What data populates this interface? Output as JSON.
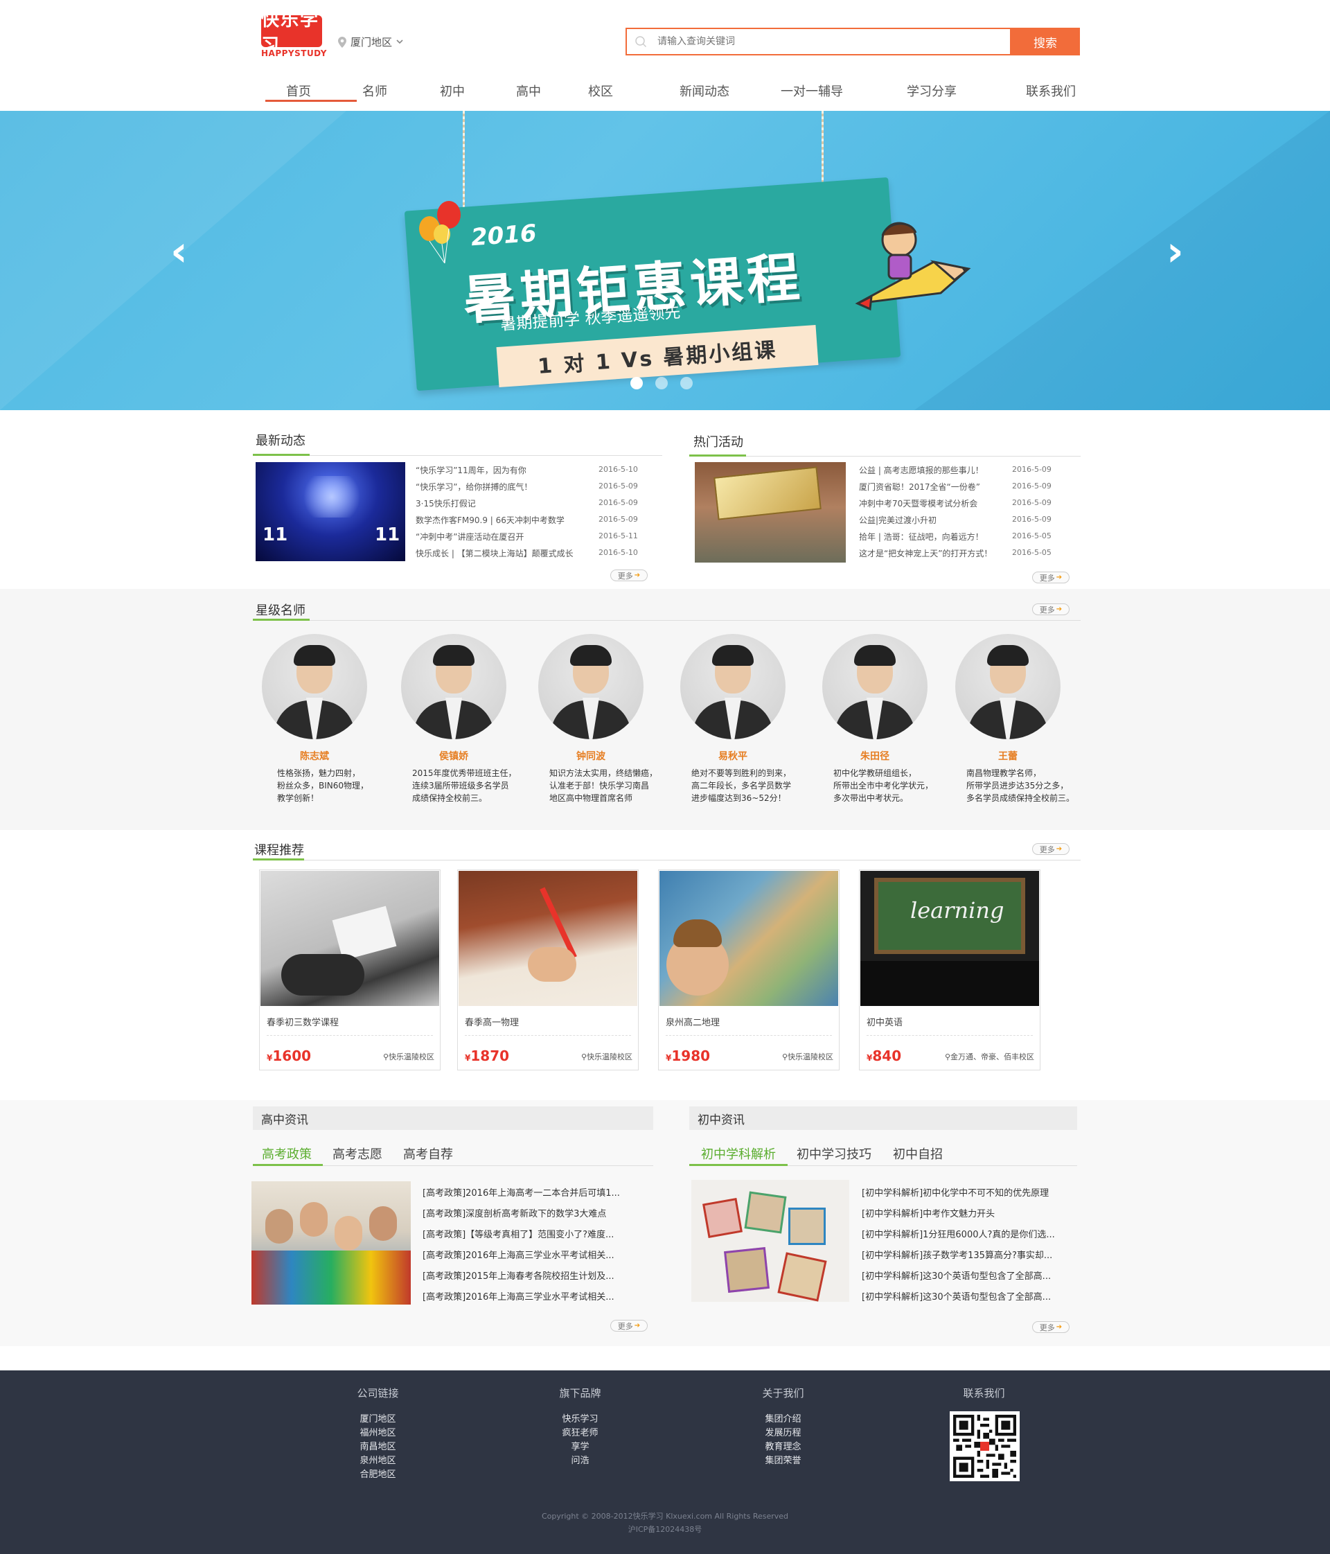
{
  "header": {
    "logo_text": "快乐学习",
    "logo_sub": "HAPPYSTUDY",
    "region": "厦门地区",
    "search_placeholder": "请输入查询关键词",
    "search_button": "搜索"
  },
  "nav": [
    "首页",
    "名师",
    "初中",
    "高中",
    "校区",
    "新闻动态",
    "一对一辅导",
    "学习分享",
    "联系我们"
  ],
  "banner": {
    "year": "2016",
    "title": "暑期钜惠课程",
    "subtitle": "暑期提前学 秋季遥遥领先",
    "tag": "1 对 1 Vs 暑期小组课",
    "slide_count": 3,
    "active_slide": 1
  },
  "latest": {
    "title": "最新动态",
    "more": "更多",
    "items": [
      {
        "text": "“快乐学习”11周年，因为有你",
        "date": "2016-5-10"
      },
      {
        "text": "“快乐学习”，给你拼搏的底气！",
        "date": "2016-5-09"
      },
      {
        "text": "3·15快乐打假记",
        "date": "2016-5-09"
      },
      {
        "text": "数学杰作客FM90.9 | 66天冲刺中考数学",
        "date": "2016-5-09"
      },
      {
        "text": "“冲刺中考”讲座活动在厦召开",
        "date": "2016-5-11"
      },
      {
        "text": "快乐成长 | 【第二模块上海站】颠覆式成长",
        "date": "2016-5-10"
      }
    ]
  },
  "hot": {
    "title": "热门活动",
    "more": "更多",
    "items": [
      {
        "text": "公益 | 高考志愿填报的那些事儿！",
        "date": "2016-5-09"
      },
      {
        "text": "厦门资省聪！2017全省“一份卷”",
        "date": "2016-5-09"
      },
      {
        "text": "冲刺中考70天暨零模考试分析会",
        "date": "2016-5-09"
      },
      {
        "text": "公益|完美过渡小升初",
        "date": "2016-5-09"
      },
      {
        "text": "拾年 | 浩哥：征战吧，向着远方！",
        "date": "2016-5-05"
      },
      {
        "text": "这才是“把女神宠上天”的打开方式！",
        "date": "2016-5-05"
      }
    ]
  },
  "teachers": {
    "title": "星级名师",
    "more": "更多",
    "items": [
      {
        "name": "陈志斌",
        "desc": [
          "性格张扬，魅力四射，",
          "粉丝众多，BIN60物理，",
          "教学创新！"
        ]
      },
      {
        "name": "侯镇娇",
        "desc": [
          "2015年度优秀带班班主任，",
          "连续3届所带班级多名学员",
          "成绩保持全校前三。"
        ]
      },
      {
        "name": "钟同波",
        "desc": [
          "知识方法太实用，终结懒癌，",
          "认准老于部！快乐学习南昌",
          "地区高中物理首席名师"
        ]
      },
      {
        "name": "易秋平",
        "desc": [
          "绝对不要等到胜利的到来，",
          "高二年段长，多名学员数学",
          "进步幅度达到36~52分！"
        ]
      },
      {
        "name": "朱田径",
        "desc": [
          "初中化学教研组组长，",
          "所带出全市中考化学状元，",
          "多次带出中考状元。"
        ]
      },
      {
        "name": "王蕾",
        "desc": [
          "南昌物理教学名师，",
          "所带学员进步达35分之多，",
          "多名学员成绩保持全校前三。"
        ]
      }
    ]
  },
  "courses": {
    "title": "课程推荐",
    "more": "更多",
    "items": [
      {
        "name": "春季初三数学课程",
        "price": "1600",
        "location": "快乐温陵校区"
      },
      {
        "name": "春季高一物理",
        "price": "1870",
        "location": "快乐温陵校区"
      },
      {
        "name": "泉州高二地理",
        "price": "1980",
        "location": "快乐温陵校区"
      },
      {
        "name": "初中英语",
        "price": "840",
        "location": "金万通、帝豪、佰丰校区"
      }
    ],
    "currency": "¥",
    "learning_text": "learning"
  },
  "hs_news": {
    "title": "高中资讯",
    "tabs": [
      "高考政策",
      "高考志愿",
      "高考自荐"
    ],
    "more": "更多",
    "items": [
      "[高考政策]2016年上海高考一二本合并后可填1...",
      "[高考政策]深度剖析高考新政下的数学3大难点",
      "[高考政策]【等级考真相了】范围变小了?难度...",
      "[高考政策]2016年上海高三学业水平考试相关...",
      "[高考政策]2015年上海春考各院校招生计划及...",
      "[高考政策]2016年上海高三学业水平考试相关..."
    ]
  },
  "ms_news": {
    "title": "初中资讯",
    "tabs": [
      "初中学科解析",
      "初中学习技巧",
      "初中自招"
    ],
    "more": "更多",
    "items": [
      "[初中学科解析]初中化学中不可不知的优先原理",
      "[初中学科解析]中考作文魅力开头",
      "[初中学科解析]1分狂甩6000人?真的是你们选...",
      "[初中学科解析]孩子数学考135算高分?事实却...",
      "[初中学科解析]这30个英语句型包含了全部高...",
      "[初中学科解析]这30个英语句型包含了全部高..."
    ]
  },
  "footer": {
    "columns": [
      {
        "title": "公司链接",
        "links": [
          "厦门地区",
          "福州地区",
          "南昌地区",
          "泉州地区",
          "合肥地区"
        ]
      },
      {
        "title": "旗下品牌",
        "links": [
          "快乐学习",
          "疯狂老师",
          "享学",
          "问浩"
        ]
      },
      {
        "title": "关于我们",
        "links": [
          "集团介绍",
          "发展历程",
          "教育理念",
          "集团荣誉"
        ]
      },
      {
        "title": "联系我们",
        "links": []
      }
    ],
    "copyright": "Copyright © 2008-2012快乐学习 Klxuexi.com All Rights Reserved",
    "icp": "沪ICP备12024438号"
  },
  "colors": {
    "accent": "#f26c3a",
    "green": "#7dc14a",
    "price": "#e8332a",
    "teacher_name": "#e67e22",
    "footer_bg": "#2f3543"
  }
}
